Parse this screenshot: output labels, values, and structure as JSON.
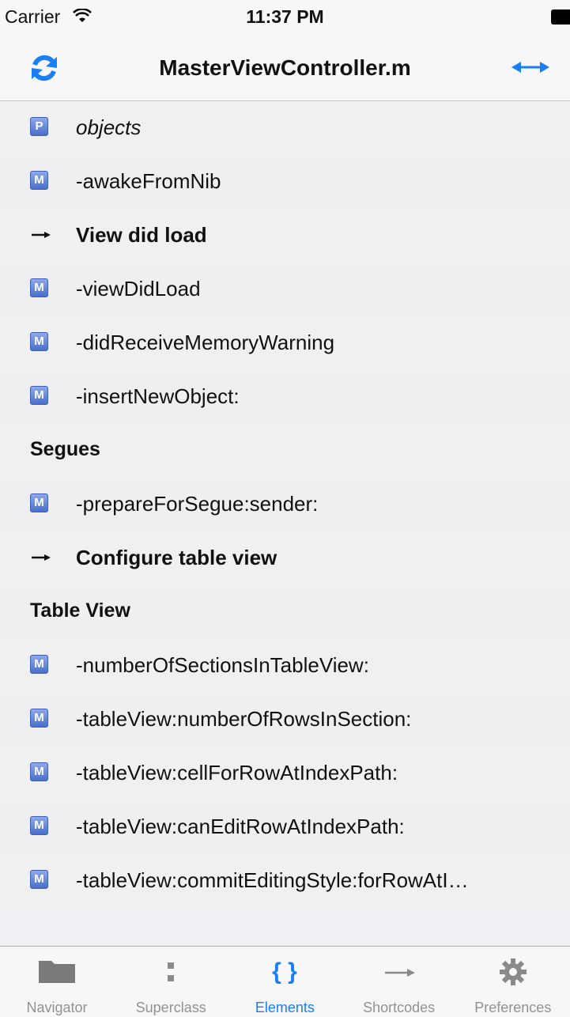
{
  "status_bar": {
    "carrier": "Carrier",
    "time": "11:37 PM"
  },
  "nav": {
    "title": "MasterViewController.m",
    "refresh_icon": "refresh-icon",
    "swap_icon": "swap-arrows-icon",
    "accent": "#1a7ef5"
  },
  "rows": [
    {
      "kind": "property",
      "badge": "P",
      "label": "objects"
    },
    {
      "kind": "method",
      "badge": "M",
      "label": "-awakeFromNib"
    },
    {
      "kind": "pragma",
      "label": "View did load"
    },
    {
      "kind": "method",
      "badge": "M",
      "label": "-viewDidLoad"
    },
    {
      "kind": "method",
      "badge": "M",
      "label": "-didReceiveMemoryWarning"
    },
    {
      "kind": "method",
      "badge": "M",
      "label": "-insertNewObject:"
    },
    {
      "kind": "section",
      "label": "Segues"
    },
    {
      "kind": "method",
      "badge": "M",
      "label": "-prepareForSegue:sender:"
    },
    {
      "kind": "pragma",
      "label": "Configure table view"
    },
    {
      "kind": "section",
      "label": "Table View"
    },
    {
      "kind": "method",
      "badge": "M",
      "label": "-numberOfSectionsInTableView:"
    },
    {
      "kind": "method",
      "badge": "M",
      "label": "-tableView:numberOfRowsInSection:"
    },
    {
      "kind": "method",
      "badge": "M",
      "label": "-tableView:cellForRowAtIndexPath:"
    },
    {
      "kind": "method",
      "badge": "M",
      "label": "-tableView:canEditRowAtIndexPath:"
    },
    {
      "kind": "method",
      "badge": "M",
      "label": "-tableView:commitEditingStyle:forRowAtI…"
    }
  ],
  "tabs": [
    {
      "label": "Navigator",
      "icon": "folder-icon"
    },
    {
      "label": "Superclass",
      "icon": "colon-icon"
    },
    {
      "label": "Elements",
      "icon": "braces-icon",
      "active": true
    },
    {
      "label": "Shortcodes",
      "icon": "arrow-right-icon"
    },
    {
      "label": "Preferences",
      "icon": "gear-icon"
    }
  ]
}
